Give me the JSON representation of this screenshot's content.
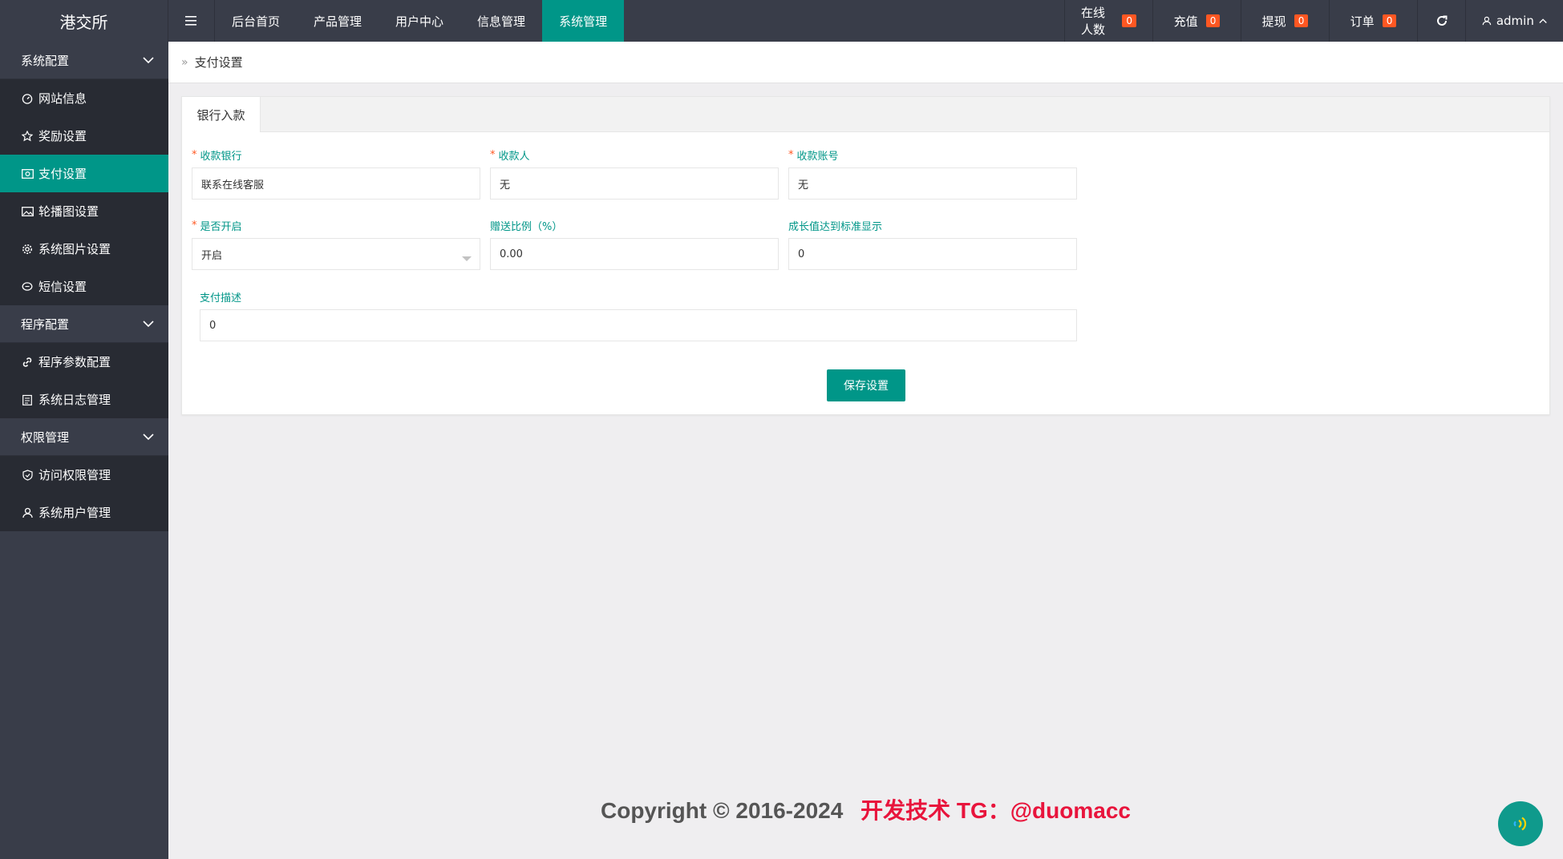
{
  "header": {
    "logo": "港交所",
    "nav": [
      "后台首页",
      "产品管理",
      "用户中心",
      "信息管理",
      "系统管理"
    ],
    "active_nav": "系统管理",
    "stats": [
      {
        "label": "在线人数",
        "count": "0"
      },
      {
        "label": "充值",
        "count": "0"
      },
      {
        "label": "提现",
        "count": "0"
      },
      {
        "label": "订单",
        "count": "0"
      }
    ],
    "user": "admin"
  },
  "sidebar": {
    "groups": [
      {
        "label": "系统配置",
        "items": [
          {
            "label": "网站信息",
            "icon": "dashboard-icon"
          },
          {
            "label": "奖励设置",
            "icon": "star-icon"
          },
          {
            "label": "支付设置",
            "icon": "rmb-icon"
          },
          {
            "label": "轮播图设置",
            "icon": "picture-icon"
          },
          {
            "label": "系统图片设置",
            "icon": "gear-icon"
          },
          {
            "label": "短信设置",
            "icon": "chat-icon"
          }
        ]
      },
      {
        "label": "程序配置",
        "items": [
          {
            "label": "程序参数配置",
            "icon": "link-icon"
          },
          {
            "label": "系统日志管理",
            "icon": "log-icon"
          }
        ]
      },
      {
        "label": "权限管理",
        "items": [
          {
            "label": "访问权限管理",
            "icon": "shield-icon"
          },
          {
            "label": "系统用户管理",
            "icon": "user-icon"
          }
        ]
      }
    ],
    "active_item": "支付设置"
  },
  "breadcrumb": {
    "current": "支付设置"
  },
  "tabs": [
    "银行入款"
  ],
  "form": {
    "bank": {
      "label": "收款银行",
      "value": "联系在线客服"
    },
    "payee": {
      "label": "收款人",
      "value": "无"
    },
    "account": {
      "label": "收款账号",
      "value": "无"
    },
    "enabled": {
      "label": "是否开启",
      "value": "开启"
    },
    "bonus_ratio": {
      "label": "赠送比例（%）",
      "value": "0.00"
    },
    "growth": {
      "label": "成长值达到标准显示",
      "value": "0"
    },
    "description": {
      "label": "支付描述",
      "value": "0"
    },
    "save_label": "保存设置"
  },
  "footer": {
    "copyright": "Copyright © 2016-2024",
    "dev": "开发技术 TG：@duomacc"
  },
  "colors": {
    "accent": "#009688",
    "header": "#393d49",
    "badge": "#ff5722",
    "footer_red": "#e8143c"
  }
}
